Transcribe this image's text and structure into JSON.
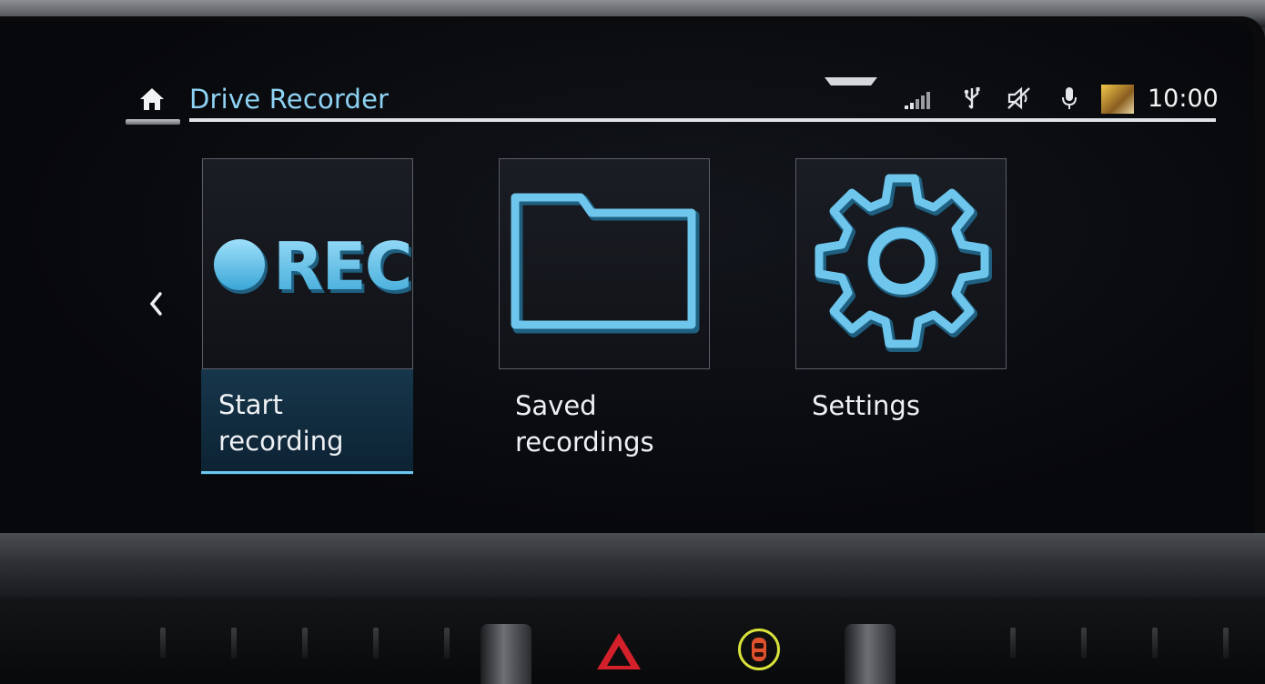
{
  "header": {
    "title": "Drive Recorder",
    "clock": "10:00"
  },
  "status_icons": [
    "signal-bars-icon",
    "usb-icon",
    "sound-muted-icon",
    "microphone-icon",
    "media-thumbnail"
  ],
  "tiles": [
    {
      "label_line1": "Start",
      "label_line2": "recording",
      "icon": "rec-icon",
      "text": "REC",
      "selected": true
    },
    {
      "label_line1": "Saved",
      "label_line2": "recordings",
      "icon": "folder-icon",
      "selected": false
    },
    {
      "label_line1": "Settings",
      "label_line2": "",
      "icon": "gear-icon",
      "selected": false
    }
  ],
  "colors": {
    "accent": "#6cc6ef",
    "title": "#8fd3f4",
    "hazard": "#d4202a",
    "car_button_ring": "#d8e23a"
  }
}
